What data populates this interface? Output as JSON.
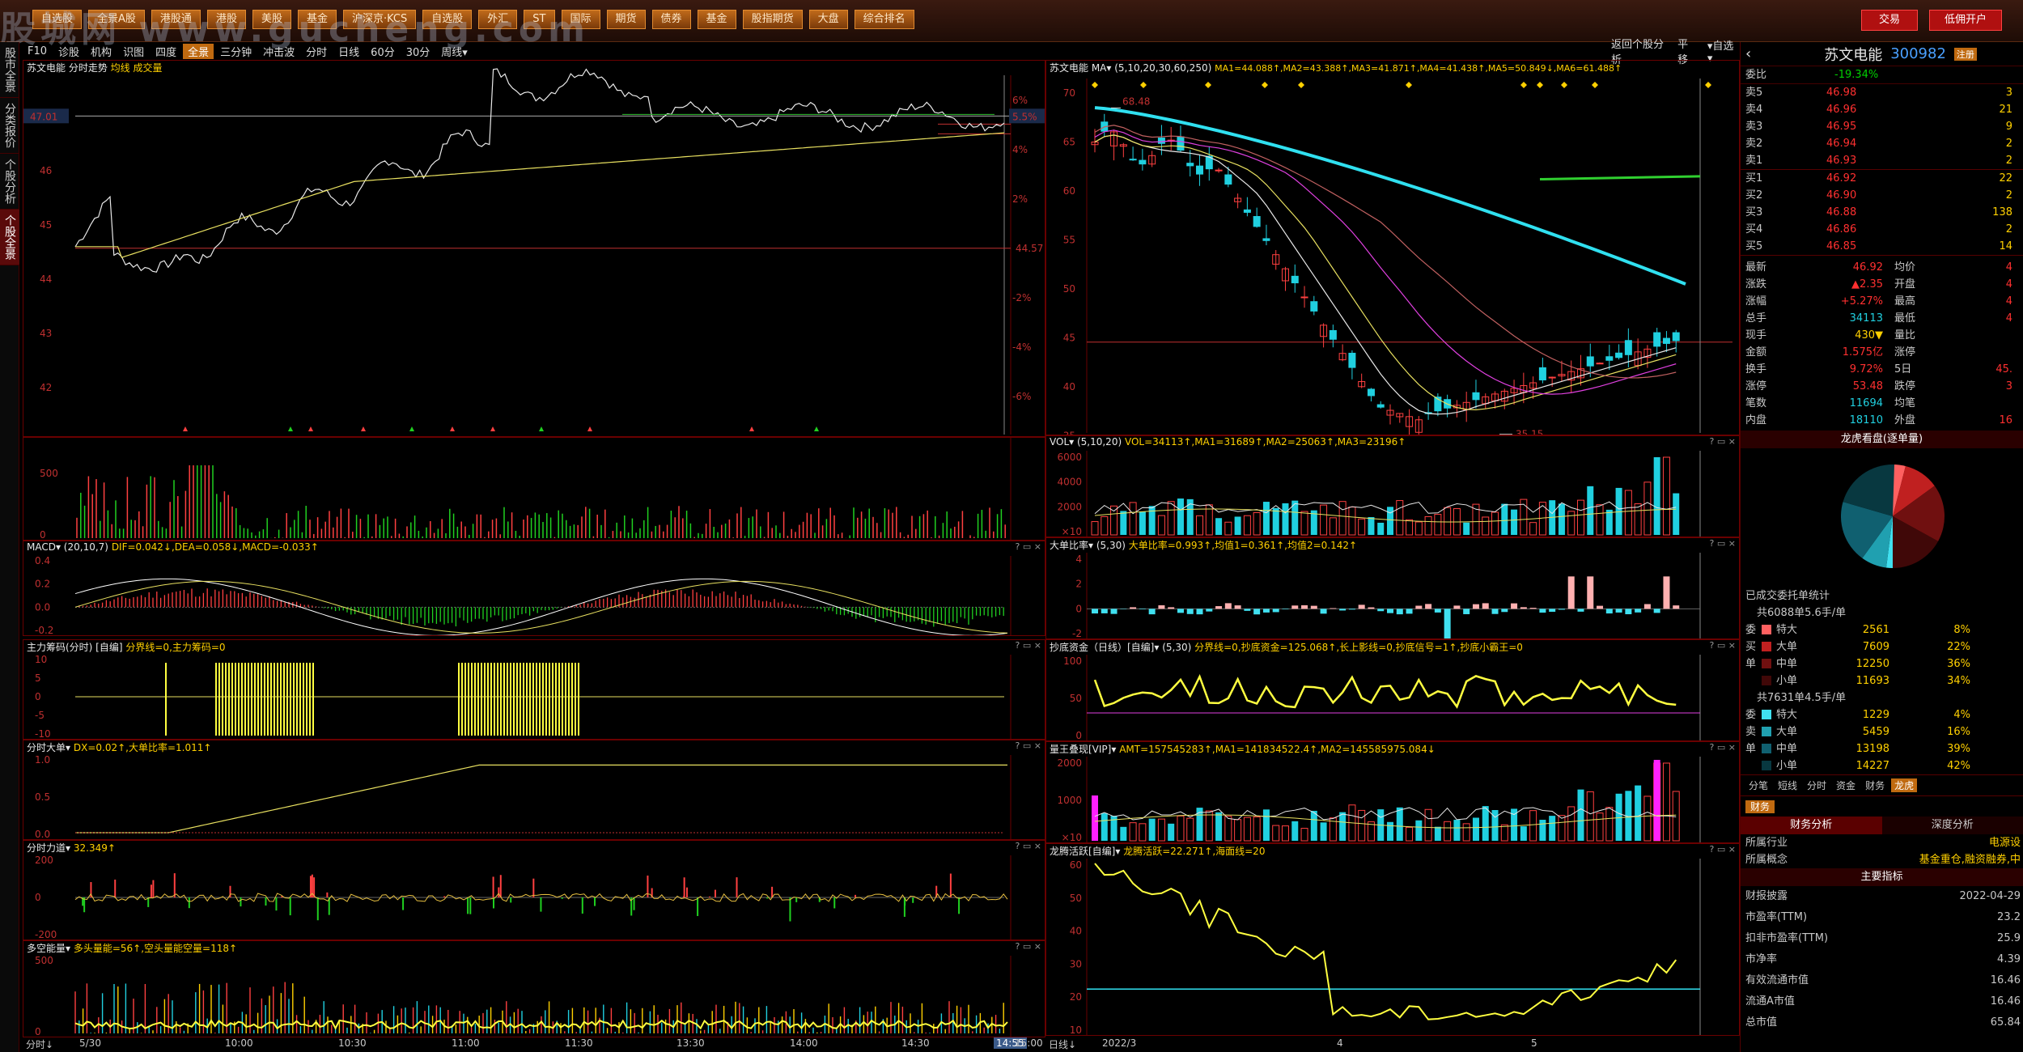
{
  "top_menu": [
    "自选股",
    "全景A股",
    "港股通",
    "港股",
    "美股",
    "基金",
    "沪深京·KCS",
    "自选股",
    "外汇",
    "ST",
    "国际",
    "期货",
    "债券",
    "基金",
    "股指期货",
    "大盘",
    "综合排名"
  ],
  "watermark": "股城网 www.gucheng.com",
  "trade_label": "交易",
  "open_label": "低佣开户",
  "left_tabs": [
    "股市全景",
    "分类报价",
    "个股分析",
    "个股全景"
  ],
  "left_toolbar": [
    "F10",
    "诊股",
    "机构",
    "识图",
    "四度",
    "全景",
    "三分钟",
    "冲击波",
    "分时",
    "日线",
    "60分",
    "30分",
    "周线▾"
  ],
  "right_toolbar": [
    "返回个股分析",
    "平移",
    "▾自选▾"
  ],
  "intraday": {
    "title": "苏文电能 分时走势",
    "title2": "均线 成交量",
    "price_label": "47.01",
    "pct_label": "5.5%",
    "mid_label": "44.57",
    "y_left": [
      "46",
      "45",
      "44",
      "43",
      "42"
    ],
    "y_right": [
      "6%",
      "4%",
      "2%",
      "-2%",
      "-4%",
      "-6%"
    ],
    "vol_axis": [
      "500",
      "0"
    ]
  },
  "subpanels_left": [
    {
      "title": "MACD▾ (20,10,7)",
      "vals": "DIF=0.042↓,DEA=0.058↓,MACD=-0.033↑",
      "axis": [
        "0.4",
        "0.2",
        "0.0",
        "-0.2"
      ]
    },
    {
      "title": "主力筹码(分时) [自编]",
      "vals": "分界线=0,主力筹码=0",
      "axis": [
        "10",
        "5",
        "0",
        "-5",
        "-10"
      ]
    },
    {
      "title": "分时大单▾",
      "vals": "DX=0.02↑,大单比率=1.011↑",
      "axis": [
        "1.0",
        "0.5",
        "0.0"
      ]
    },
    {
      "title": "分时力道▾",
      "vals": "32.349↑",
      "axis": [
        "200",
        "0",
        "-200"
      ]
    },
    {
      "title": "多空能量▾",
      "vals": "多头量能=56↑,空头量能空量=118↑",
      "axis": [
        "500",
        "0"
      ]
    }
  ],
  "left_time": [
    "分时↓",
    "5/30",
    "10:00",
    "10:30",
    "11:00",
    "11:30",
    "13:30",
    "14:00",
    "14:30",
    "14:55",
    "15:00"
  ],
  "kline": {
    "title": "苏文电能 MA▾ (5,10,20,30,60,250)",
    "ma": "MA1=44.088↑,MA2=43.388↑,MA3=41.871↑,MA4=41.438↑,MA5=50.849↓,MA6=61.488↑",
    "y": [
      "70",
      "65",
      "60",
      "55",
      "50",
      "45",
      "40",
      "35"
    ],
    "hi_label": "68.48",
    "lo_label": "35.15"
  },
  "subpanels_right": [
    {
      "title": "VOL▾ (5,10,20)",
      "vals": "VOL=34113↑,MA1=31689↑,MA2=25063↑,MA3=23196↑",
      "axis": [
        "6000",
        "4000",
        "2000",
        "×10"
      ]
    },
    {
      "title": "大单比率▾ (5,30)",
      "vals": "大单比率=0.993↑,均值1=0.361↑,均值2=0.142↑",
      "axis": [
        "4",
        "2",
        "0",
        "-2"
      ]
    },
    {
      "title": "抄底资金（日线）[自编]▾ (5,30)",
      "vals": "分界线=0,抄底资金=125.068↑,长上影线=0,抄底信号=1↑,抄底小霸王=0",
      "axis": [
        "100",
        "50",
        "0"
      ]
    },
    {
      "title": "量王叠现[VIP]▾",
      "vals": "AMT=157545283↑,MA1=141834522.4↑,MA2=145585975.084↓",
      "axis": [
        "2000",
        "1000",
        "×10"
      ]
    },
    {
      "title": "龙腾活跃[自编]▾",
      "vals": "龙腾活跃=22.271↑,海面线=20",
      "axis": [
        "60",
        "50",
        "40",
        "30",
        "20",
        "10"
      ]
    }
  ],
  "right_time": [
    "日线↓",
    "2022/3",
    "4",
    "5"
  ],
  "quote": {
    "name": "苏文电能",
    "code": "300982",
    "badge": "注册",
    "weibi_label": "委比",
    "weibi": "-19.34%",
    "sell": [
      [
        "卖5",
        "46.98",
        "3"
      ],
      [
        "卖4",
        "46.96",
        "21"
      ],
      [
        "卖3",
        "46.95",
        "9"
      ],
      [
        "卖2",
        "46.94",
        "2"
      ],
      [
        "卖1",
        "46.93",
        "2"
      ]
    ],
    "buy": [
      [
        "买1",
        "46.92",
        "22"
      ],
      [
        "买2",
        "46.90",
        "2"
      ],
      [
        "买3",
        "46.88",
        "138"
      ],
      [
        "买4",
        "46.86",
        "2"
      ],
      [
        "买5",
        "46.85",
        "14"
      ]
    ],
    "stats": [
      [
        "最新",
        "46.92",
        "均价",
        "4"
      ],
      [
        "涨跌",
        "▲2.35",
        "开盘",
        "4"
      ],
      [
        "涨幅",
        "+5.27%",
        "最高",
        "4"
      ],
      [
        "总手",
        "34113",
        "最低",
        "4"
      ],
      [
        "现手",
        "430▼",
        "量比",
        ""
      ],
      [
        "金额",
        "1.575亿",
        "涨停",
        ""
      ],
      [
        "换手",
        "9.72%",
        "5日",
        "45."
      ],
      [
        "涨停",
        "53.48",
        "跌停",
        "3"
      ],
      [
        "笔数",
        "11694",
        "均笔",
        ""
      ],
      [
        "内盘",
        "18110",
        "外盘",
        "16"
      ]
    ],
    "pie_title": "龙虎看盘(逐单量)",
    "entrust_title": "已成交委托单统计",
    "buy_total": "共6088单5.6手/单",
    "buy_rows": [
      [
        "特大",
        "2561",
        "8%"
      ],
      [
        "大单",
        "7609",
        "22%"
      ],
      [
        "中单",
        "12250",
        "36%"
      ],
      [
        "小单",
        "11693",
        "34%"
      ]
    ],
    "buy_side_labels": [
      "委",
      "买",
      "单",
      ""
    ],
    "sell_total": "共7631单4.5手/单",
    "sell_rows": [
      [
        "特大",
        "1229",
        "4%"
      ],
      [
        "大单",
        "5459",
        "16%"
      ],
      [
        "中单",
        "13198",
        "39%"
      ],
      [
        "小单",
        "14227",
        "42%"
      ]
    ],
    "sell_side_labels": [
      "委",
      "卖",
      "单",
      ""
    ],
    "tabs": [
      "分笔",
      "短线",
      "分时",
      "资金",
      "财务",
      "龙虎"
    ],
    "fin_tab": "财务",
    "fin_sub": [
      "财务分析",
      "深度分析"
    ],
    "industry": [
      [
        "所属行业",
        "电源设"
      ],
      [
        "所属概念",
        "基金重仓,融资融券,中"
      ]
    ],
    "main_index": "主要指标",
    "fin_rows": [
      [
        "财报披露",
        "2022-04-29"
      ],
      [
        "市盈率(TTM)",
        "23.2"
      ],
      [
        "扣非市盈率(TTM)",
        "25.9"
      ],
      [
        "市净率",
        "4.39"
      ],
      [
        "有效流通市值",
        "16.46"
      ],
      [
        "流通A市值",
        "16.46"
      ],
      [
        "总市值",
        "65.84"
      ]
    ]
  }
}
